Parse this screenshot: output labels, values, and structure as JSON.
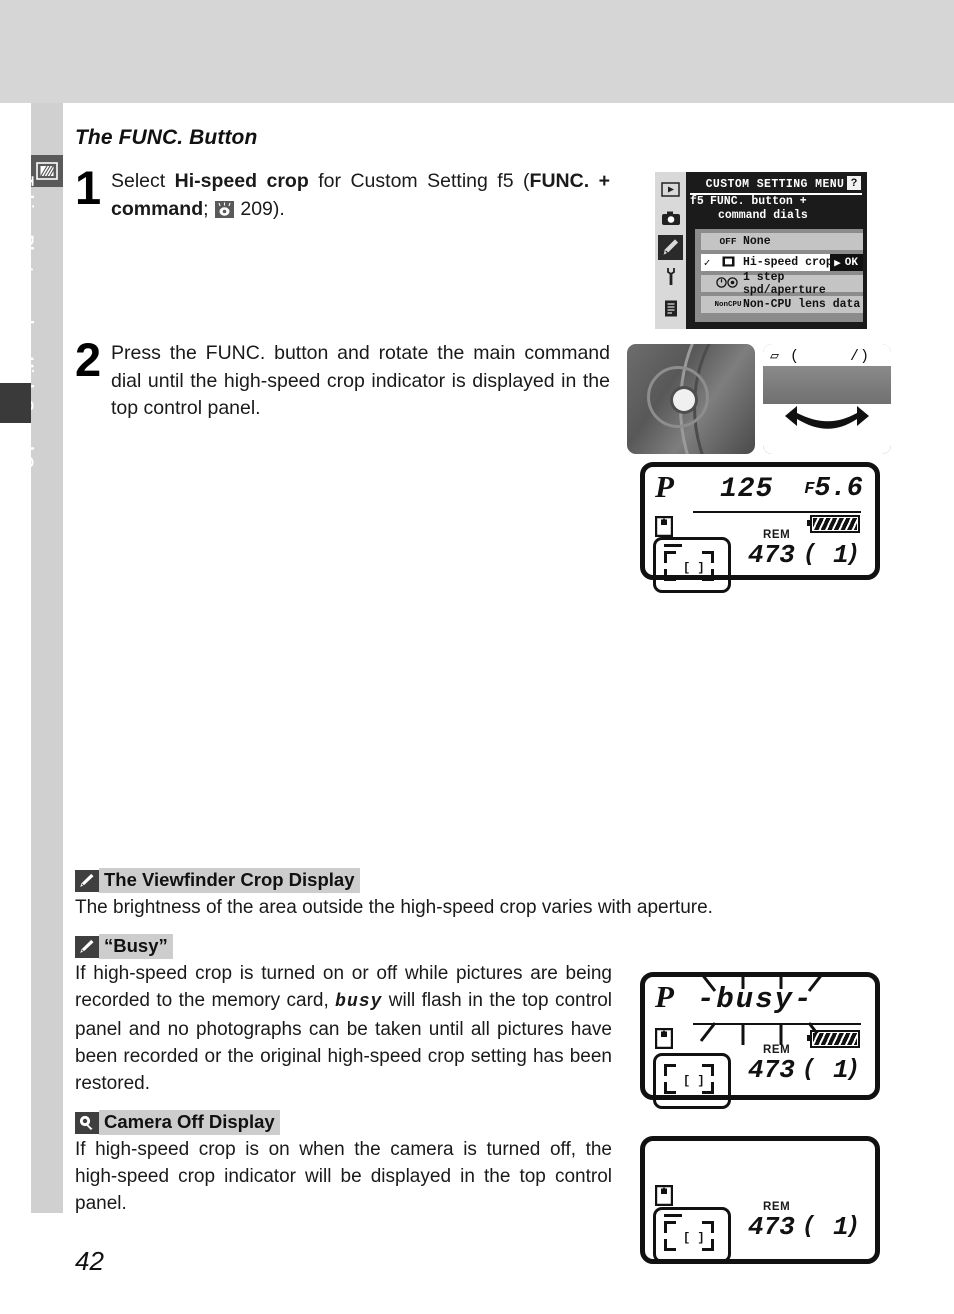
{
  "chapter_rail": {
    "label": "Taking Photographs—High-Speed Crop",
    "icon": "camera-frame-icon"
  },
  "section": {
    "title": "The FUNC. Button"
  },
  "steps": [
    {
      "number": "1",
      "text_parts": {
        "a": "Select ",
        "b": "Hi-speed crop",
        "c": " for Custom Setting f5 (",
        "d": "FUNC. + command",
        "e": "; ",
        "f": " 209)."
      }
    },
    {
      "number": "2",
      "text": "Press the FUNC. button and rotate the main command dial until the high-speed crop indicator is displayed in the top control panel."
    }
  ],
  "menu_screenshot": {
    "header": "CUSTOM SETTING MENU",
    "help_badge": "?",
    "setting_number": "f5",
    "setting_line1": "FUNC. button +",
    "setting_line2": "command dials",
    "rail_icons": [
      "playback-icon",
      "shooting-menu-icon",
      "custom-setting-pencil-icon",
      "setup-wrench-icon",
      "recent-settings-icon"
    ],
    "selected_rail_index": 2,
    "rows": [
      {
        "tag": "OFF",
        "label": "None",
        "checked": false,
        "highlighted": false
      },
      {
        "tag": "crop",
        "label": "Hi-speed crop",
        "checked": true,
        "highlighted": true,
        "ok_arrow": "▶",
        "ok_text": "OK"
      },
      {
        "tag": "spd",
        "label": "1 step spd/aperture",
        "checked": false,
        "highlighted": false
      },
      {
        "tag": "NonCPU",
        "label": "Non-CPU lens data",
        "checked": false,
        "highlighted": false
      }
    ]
  },
  "photos": {
    "func_button": "camera-front-func-button-photo",
    "command_dial": "main-command-dial-photo",
    "rotate_arrow": "rotate-arrow-icon"
  },
  "lcd_main": {
    "mode": "P",
    "shutter_speed": "125",
    "aperture_prefix": "F",
    "aperture": "5.6",
    "card_icon": "memory-card-icon",
    "crop_indicator": "high-speed-crop-icon",
    "crop_inner_mark": "[ ]",
    "rem_label": "REM",
    "rem_value": "473",
    "buffer_open": "(",
    "buffer_value": "1",
    "buffer_close": ")",
    "battery": "battery-full-icon"
  },
  "lcd_busy": {
    "mode": "P",
    "busy_text": "-busy-",
    "card_icon": "memory-card-icon",
    "crop_indicator": "high-speed-crop-icon",
    "crop_inner_mark": "[ ]",
    "rem_label": "REM",
    "rem_value": "473",
    "buffer_open": "(",
    "buffer_value": "1",
    "buffer_close": ")",
    "battery": "battery-full-icon",
    "flashing": true
  },
  "lcd_off": {
    "card_icon": "memory-card-icon",
    "crop_indicator": "high-speed-crop-icon",
    "crop_inner_mark": "[ ]",
    "rem_label": "REM",
    "rem_value": "473",
    "buffer_open": "(",
    "buffer_value": "1",
    "buffer_close": ")"
  },
  "notes": [
    {
      "icon": "pencil-note-icon",
      "title": "The Viewfinder Crop Display",
      "body": "The brightness of the area outside the high-speed crop varies with aperture."
    },
    {
      "icon": "pencil-note-icon",
      "title": "“Busy”",
      "body_a": "If high-speed crop is turned on or off while pictures are being recorded to the memory card, ",
      "glyph": "busy",
      "body_b": " will flash in the top control panel and no photographs can be taken until all pictures have been recorded or the original high-speed crop setting has been restored."
    },
    {
      "icon": "magnifier-note-icon",
      "title": "Camera Off Display",
      "body": "If high-speed crop is on when the camera is turned off, the high-speed crop indicator will be displayed in the top control panel."
    }
  ],
  "page_number": "42"
}
